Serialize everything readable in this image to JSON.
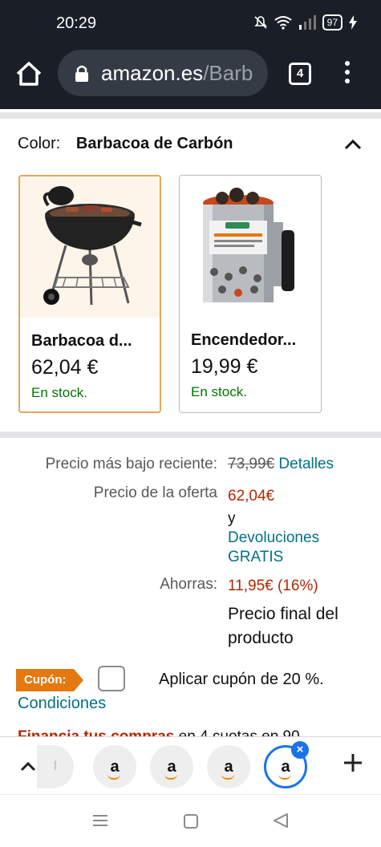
{
  "status_bar": {
    "time": "20:29",
    "battery": "97",
    "icons": [
      "mute-icon",
      "wifi-icon",
      "signal-icon",
      "battery-icon",
      "charging-icon"
    ]
  },
  "browser": {
    "url_host": "amazon.es",
    "url_path": "/Barb",
    "tab_count": "4",
    "icons": [
      "home-icon",
      "lock-icon",
      "tabs-icon",
      "overflow-menu-icon"
    ]
  },
  "color_selector": {
    "label": "Color:",
    "value": "Barbacoa de Carbón",
    "variants": [
      {
        "name": "Barbacoa d...",
        "price": "62,04 €",
        "stock": "En stock.",
        "selected": true
      },
      {
        "name": "Encendedor...",
        "price": "19,99 €",
        "stock": "En stock.",
        "selected": false
      }
    ]
  },
  "pricing": {
    "recent_low_label": "Precio más bajo reciente:",
    "recent_low_value": "73,99€",
    "details_link": "Detalles",
    "offer_label": "Precio de la oferta",
    "offer_value": "62,04€",
    "and_text": "y",
    "returns_line1": "Devoluciones",
    "returns_line2": "GRATIS",
    "savings_label": "Ahorras:",
    "savings_value": "11,95€ (16%)",
    "final_line1": "Precio final del",
    "final_line2": "producto"
  },
  "coupon": {
    "badge": "Cupón:",
    "text": "Aplicar cupón de 20 %.",
    "conditions": "Condiciones"
  },
  "finance": {
    "bold": "Financia tus compras",
    "rest": " en 4 cuotas en 90"
  },
  "tab_group": {
    "tab_glyph": "a",
    "partial_glyph": "l",
    "close": "×"
  },
  "colors": {
    "accent_blue": "#1a73e8",
    "amazon_orange": "#e47911",
    "price_red": "#b12704",
    "stock_green": "#007600",
    "link_teal": "#007185"
  }
}
